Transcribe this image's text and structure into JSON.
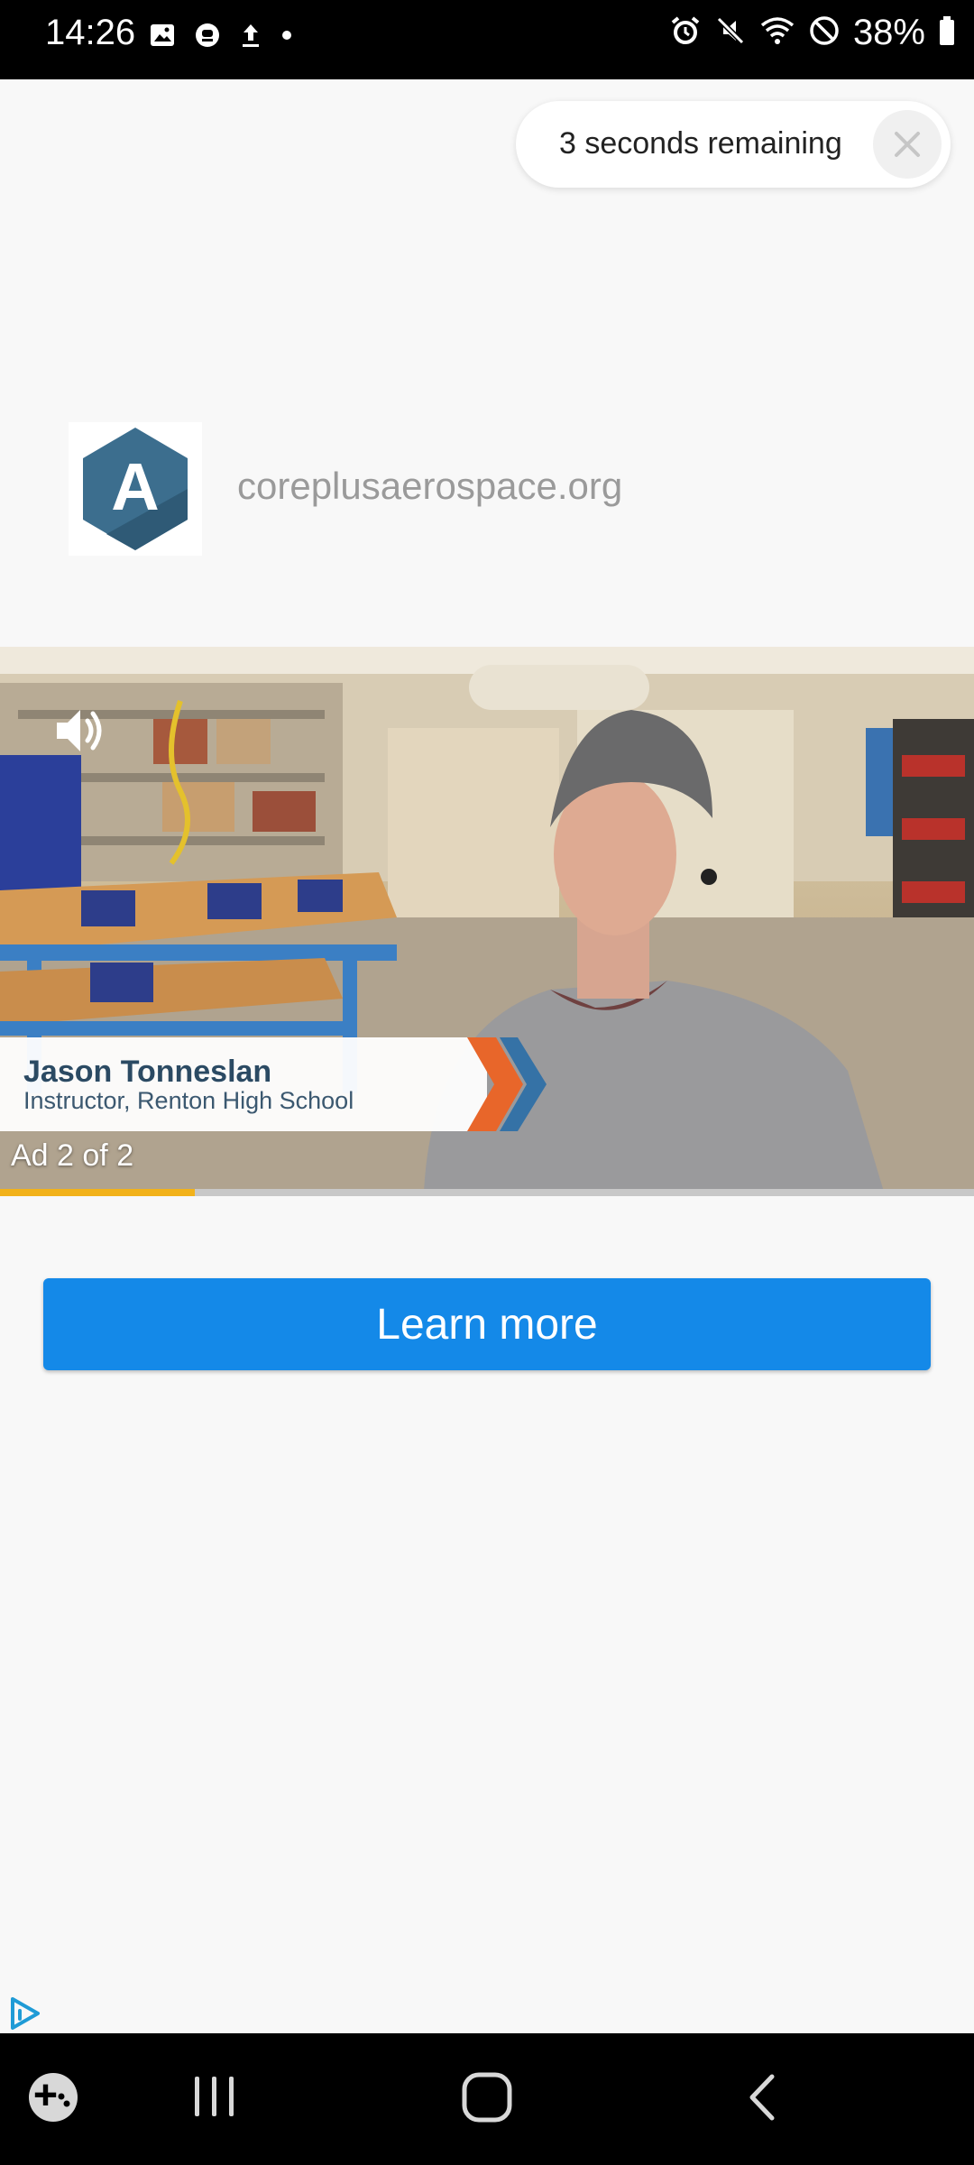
{
  "status_bar": {
    "time": "14:26",
    "battery_percent": "38%",
    "left_icons": [
      "image-notification-icon",
      "app-notification-icon",
      "upload-icon",
      "dot-icon"
    ],
    "right_icons": [
      "alarm-icon",
      "mute-icon",
      "wifi-icon",
      "do-not-disturb-icon",
      "battery-icon"
    ]
  },
  "ad": {
    "countdown_text": "3 seconds remaining",
    "advertiser_domain": "coreplusaerospace.org",
    "logo_letter": "A",
    "video": {
      "person_name": "Jason Tonneslan",
      "person_title": "Instructor, Renton High School",
      "ad_counter": "Ad 2 of 2",
      "progress_fraction": 0.2
    },
    "cta_label": "Learn more"
  },
  "colors": {
    "cta": "#1489e8",
    "progress": "#f2b21b",
    "logo": "#3c6e8e"
  },
  "nav_bar": {
    "items": [
      "game-launcher-icon",
      "recent-apps-icon",
      "home-icon",
      "back-icon"
    ]
  }
}
